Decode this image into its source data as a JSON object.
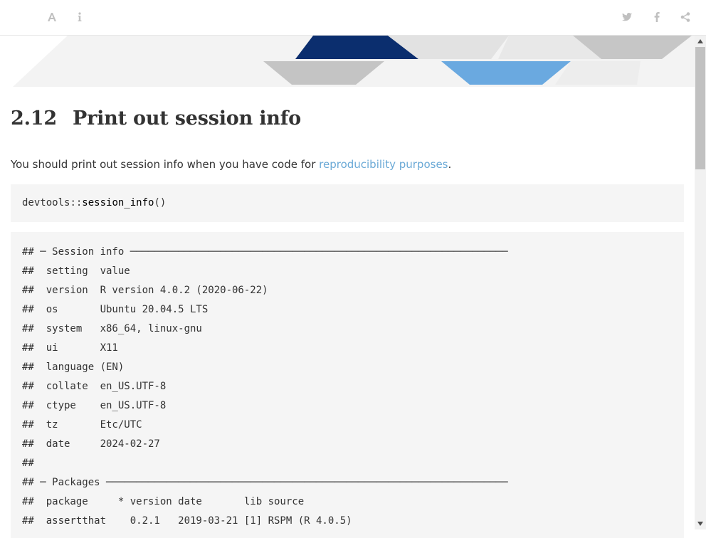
{
  "toolbar": {
    "left_icons": [
      "font-settings-icon",
      "info-icon"
    ],
    "right_icons": [
      "twitter-icon",
      "facebook-icon",
      "share-icon"
    ]
  },
  "section": {
    "number": "2.12",
    "title": "Print out session info"
  },
  "paragraph": {
    "before": "You should print out session info when you have code for ",
    "link": "reproducibility purposes",
    "after": "."
  },
  "code": {
    "ns": "devtools",
    "op": "::",
    "fn": "session_info",
    "args": "()"
  },
  "output": {
    "lines": [
      "## ─ Session info ───────────────────────────────────────────────────────────────",
      "##  setting  value",
      "##  version  R version 4.0.2 (2020-06-22)",
      "##  os       Ubuntu 20.04.5 LTS",
      "##  system   x86_64, linux-gnu",
      "##  ui       X11",
      "##  language (EN)",
      "##  collate  en_US.UTF-8",
      "##  ctype    en_US.UTF-8",
      "##  tz       Etc/UTC",
      "##  date     2024-02-27",
      "##",
      "## ─ Packages ───────────────────────────────────────────────────────────────────",
      "##  package     * version date       lib source",
      "##  assertthat    0.2.1   2019-03-21 [1] RSPM (R 4.0.5)"
    ]
  },
  "colors": {
    "link": "#6aa9d6",
    "banner_dark": "#0b2e6e",
    "banner_light_blue": "#6aa9e0",
    "banner_gray": "#c8c8c8",
    "code_bg": "#f5f5f5"
  }
}
